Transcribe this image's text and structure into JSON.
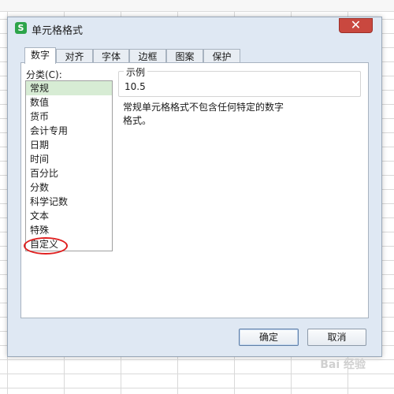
{
  "dialog": {
    "title": "单元格格式",
    "app_icon_letter": "S",
    "close_glyph": "✕",
    "tabs": [
      {
        "label": "数字",
        "active": true
      },
      {
        "label": "对齐"
      },
      {
        "label": "字体"
      },
      {
        "label": "边框"
      },
      {
        "label": "图案"
      },
      {
        "label": "保护"
      }
    ],
    "category_label": "分类(C):",
    "categories": [
      "常规",
      "数值",
      "货币",
      "会计专用",
      "日期",
      "时间",
      "百分比",
      "分数",
      "科学记数",
      "文本",
      "特殊",
      "自定义"
    ],
    "selected_category": "常规",
    "sample_legend": "示例",
    "sample_value": "10.5",
    "description_lines": [
      "常规单元格格式不包含任何特定的数字",
      "格式。"
    ],
    "ok_label": "确定",
    "cancel_label": "取消"
  },
  "watermark": "Bai 经验",
  "colors": {
    "dialog_bg": "#dfe8f3",
    "close_button": "#c9483f",
    "selected_item": "#d7ecd4",
    "annotation": "#e02020",
    "app_icon": "#2da44a"
  },
  "icons": {
    "app": "wps-spreadsheet-icon",
    "close": "close-icon"
  }
}
